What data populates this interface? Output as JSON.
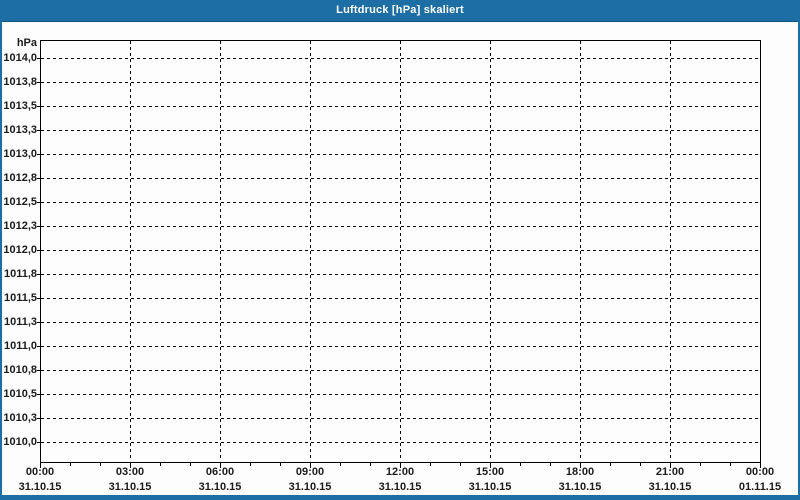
{
  "window": {
    "title": "Luftdruck [hPa] skaliert"
  },
  "theme": {
    "titlebar_bg": "#1c6ea4",
    "titlebar_edge": "#11517e",
    "frame_color": "#1c6ea4",
    "title_text_color": "#ffffff",
    "window_bg": "#fcfdfc",
    "label_color": "#1b1b1b",
    "grid_color": "#000000",
    "axis_color": "#000000"
  },
  "chart_data": {
    "type": "line",
    "title": "Luftdruck [hPa] skaliert",
    "unit": "hPa",
    "grid": "dashed",
    "legend": "none",
    "y_axis": {
      "min": 1010.0,
      "max": 1014.0,
      "step": 0.25,
      "tick_labels": [
        "1014,0",
        "1013,8",
        "1013,5",
        "1013,3",
        "1013,0",
        "1012,8",
        "1012,5",
        "1012,3",
        "1012,0",
        "1011,8",
        "1011,5",
        "1011,3",
        "1011,0",
        "1010,8",
        "1010,5",
        "1010,3",
        "1010,0"
      ]
    },
    "x_axis": {
      "minor_ticks_per_major": 3,
      "major_ticks": [
        {
          "time": "00:00",
          "date": "31.10.15"
        },
        {
          "time": "03:00",
          "date": "31.10.15"
        },
        {
          "time": "06:00",
          "date": "31.10.15"
        },
        {
          "time": "09:00",
          "date": "31.10.15"
        },
        {
          "time": "12:00",
          "date": "31.10.15"
        },
        {
          "time": "15:00",
          "date": "31.10.15"
        },
        {
          "time": "18:00",
          "date": "31.10.15"
        },
        {
          "time": "21:00",
          "date": "31.10.15"
        },
        {
          "time": "00:00",
          "date": "01.11.15"
        }
      ]
    },
    "series": []
  }
}
